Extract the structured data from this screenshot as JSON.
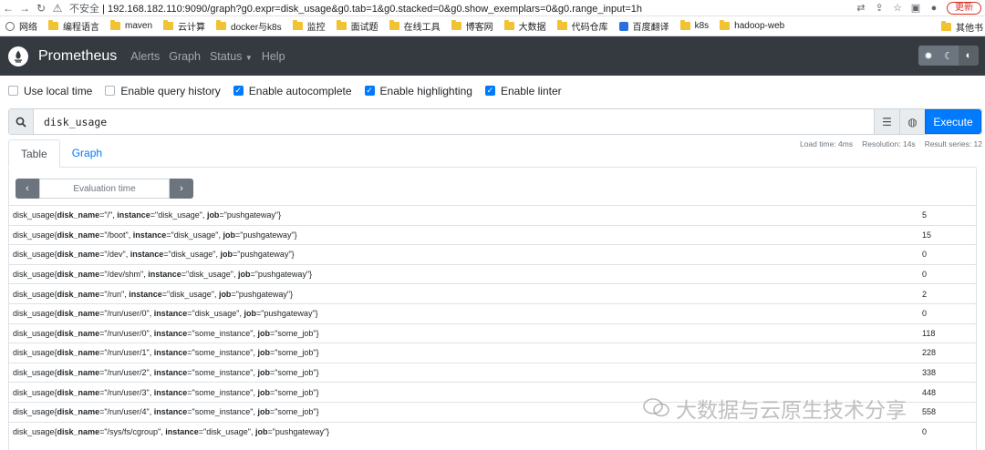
{
  "browser": {
    "security_label": "不安全",
    "url": "192.168.182.110:9090/graph?g0.expr=disk_usage&g0.tab=1&g0.stacked=0&g0.show_exemplars=0&g0.range_input=1h",
    "update_label": "更新",
    "bookmarks": [
      {
        "label": "网络",
        "icon": "globe-icon"
      },
      {
        "label": "编程语言",
        "icon": "folder-icon"
      },
      {
        "label": "maven",
        "icon": "folder-icon"
      },
      {
        "label": "云计算",
        "icon": "folder-icon"
      },
      {
        "label": "docker与k8s",
        "icon": "folder-icon"
      },
      {
        "label": "监控",
        "icon": "folder-icon"
      },
      {
        "label": "面试题",
        "icon": "folder-icon"
      },
      {
        "label": "在线工具",
        "icon": "folder-icon"
      },
      {
        "label": "博客网",
        "icon": "folder-icon"
      },
      {
        "label": "大数据",
        "icon": "folder-icon"
      },
      {
        "label": "代码仓库",
        "icon": "folder-icon"
      },
      {
        "label": "百度翻译",
        "icon": "blue-square-icon"
      },
      {
        "label": "k8s",
        "icon": "folder-icon"
      },
      {
        "label": "hadoop-web",
        "icon": "folder-icon"
      }
    ],
    "bookmarks_more": "其他书"
  },
  "nav": {
    "brand": "Prometheus",
    "links": [
      "Alerts",
      "Graph",
      "Status",
      "Help"
    ]
  },
  "options": [
    {
      "label": "Use local time",
      "checked": false
    },
    {
      "label": "Enable query history",
      "checked": false
    },
    {
      "label": "Enable autocomplete",
      "checked": true
    },
    {
      "label": "Enable highlighting",
      "checked": true
    },
    {
      "label": "Enable linter",
      "checked": true
    }
  ],
  "query": {
    "expr": "disk_usage",
    "execute_label": "Execute"
  },
  "tabs": [
    "Table",
    "Graph"
  ],
  "stats": {
    "load_time": "Load time: 4ms",
    "resolution": "Resolution: 14s",
    "result_series": "Result series: 12"
  },
  "eval": {
    "placeholder": "Evaluation time",
    "prev": "‹",
    "next": "›"
  },
  "results": [
    {
      "disk_name": "/",
      "instance": "disk_usage",
      "job": "pushgateway",
      "value": "5"
    },
    {
      "disk_name": "/boot",
      "instance": "disk_usage",
      "job": "pushgateway",
      "value": "15"
    },
    {
      "disk_name": "/dev",
      "instance": "disk_usage",
      "job": "pushgateway",
      "value": "0"
    },
    {
      "disk_name": "/dev/shm",
      "instance": "disk_usage",
      "job": "pushgateway",
      "value": "0"
    },
    {
      "disk_name": "/run",
      "instance": "disk_usage",
      "job": "pushgateway",
      "value": "2"
    },
    {
      "disk_name": "/run/user/0",
      "instance": "disk_usage",
      "job": "pushgateway",
      "value": "0"
    },
    {
      "disk_name": "/run/user/0",
      "instance": "some_instance",
      "job": "some_job",
      "value": "118"
    },
    {
      "disk_name": "/run/user/1",
      "instance": "some_instance",
      "job": "some_job",
      "value": "228"
    },
    {
      "disk_name": "/run/user/2",
      "instance": "some_instance",
      "job": "some_job",
      "value": "338"
    },
    {
      "disk_name": "/run/user/3",
      "instance": "some_instance",
      "job": "some_job",
      "value": "448"
    },
    {
      "disk_name": "/run/user/4",
      "instance": "some_instance",
      "job": "some_job",
      "value": "558"
    },
    {
      "disk_name": "/sys/fs/cgroup",
      "instance": "disk_usage",
      "job": "pushgateway",
      "value": "0"
    }
  ],
  "metric_name": "disk_usage",
  "label_keys": {
    "disk_name": "disk_name",
    "instance": "instance",
    "job": "job"
  },
  "watermark": "大数据与云原生技术分享"
}
